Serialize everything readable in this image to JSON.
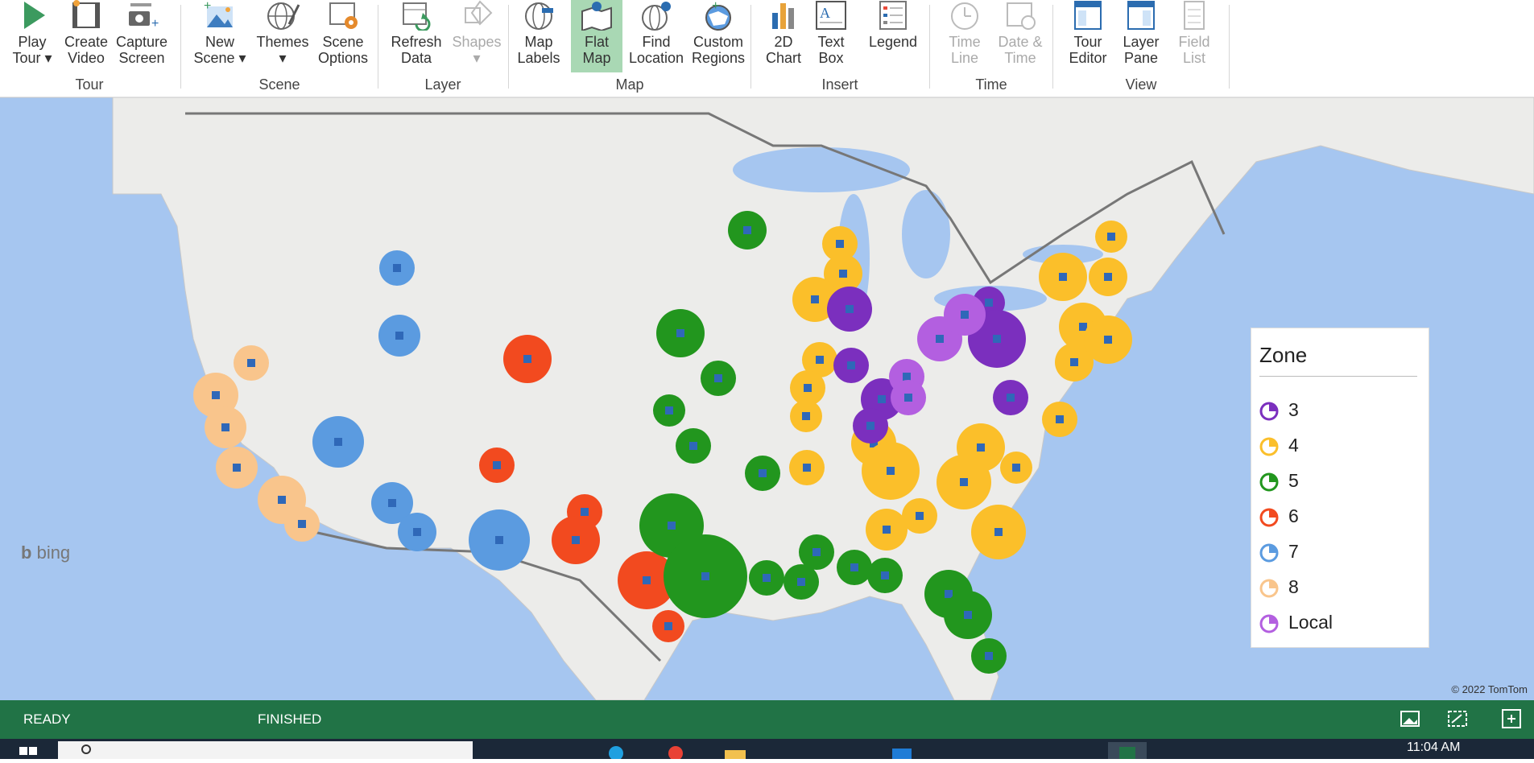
{
  "ribbon": {
    "groups": [
      {
        "label": "Tour"
      },
      {
        "label": "Scene"
      },
      {
        "label": "Layer"
      },
      {
        "label": "Map"
      },
      {
        "label": "Insert"
      },
      {
        "label": "Time"
      },
      {
        "label": "View"
      }
    ],
    "buttons": {
      "play_tour": [
        "Play",
        "Tour ▾"
      ],
      "create_video": [
        "Create",
        "Video"
      ],
      "capture_screen": [
        "Capture",
        "Screen"
      ],
      "new_scene": [
        "New",
        "Scene ▾"
      ],
      "themes": [
        "Themes",
        "▾"
      ],
      "scene_options": [
        "Scene",
        "Options"
      ],
      "refresh_data": [
        "Refresh",
        "Data"
      ],
      "shapes": [
        "Shapes",
        "▾"
      ],
      "map_labels": [
        "Map",
        "Labels"
      ],
      "flat_map": [
        "Flat",
        "Map"
      ],
      "find_location": [
        "Find",
        "Location"
      ],
      "custom_regions": [
        "Custom",
        "Regions"
      ],
      "chart_2d": [
        "2D",
        "Chart"
      ],
      "text_box": [
        "Text",
        "Box"
      ],
      "legend": [
        "Legend",
        ""
      ],
      "time_line": [
        "Time",
        "Line"
      ],
      "date_time": [
        "Date &",
        "Time"
      ],
      "tour_editor": [
        "Tour",
        "Editor"
      ],
      "layer_pane": [
        "Layer",
        "Pane"
      ],
      "field_list": [
        "Field",
        "List"
      ]
    }
  },
  "legend": {
    "title": "Zone",
    "items": [
      {
        "label": "3",
        "color": "#7b2fbe"
      },
      {
        "label": "4",
        "color": "#fbbf2a"
      },
      {
        "label": "5",
        "color": "#22961e"
      },
      {
        "label": "6",
        "color": "#f24a1f"
      },
      {
        "label": "7",
        "color": "#5b9be0"
      },
      {
        "label": "8",
        "color": "#f9c58c"
      },
      {
        "label": "Local",
        "color": "#b35fe0"
      }
    ]
  },
  "map": {
    "brand": "bing",
    "copyright": "© 2022 TomTom"
  },
  "status": {
    "left": "READY",
    "middle": "FINISHED"
  },
  "taskbar": {
    "time": "11:04 AM"
  },
  "colors": {
    "excel_green": "#217346",
    "active_button": "#a9d8b4",
    "water": "#a6c6f0",
    "land": "#ececea"
  }
}
